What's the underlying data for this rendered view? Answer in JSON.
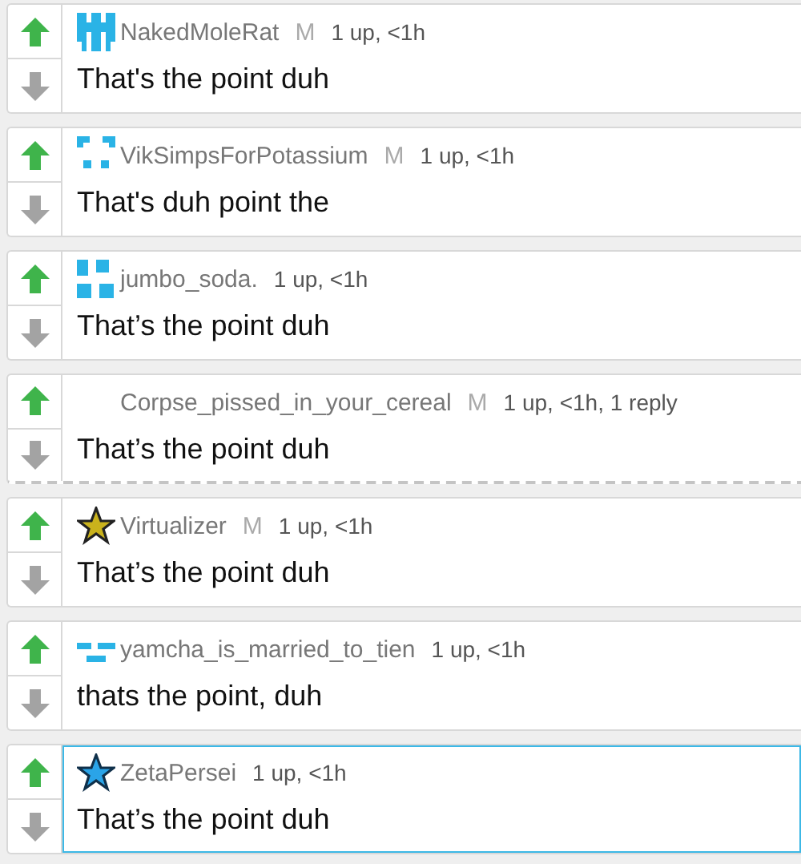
{
  "comments": [
    {
      "avatar": {
        "kind": "invader"
      },
      "username": "NakedMoleRat",
      "mod_badge": "M",
      "meta": "1 up, <1h",
      "text": "That's the point duh",
      "upvoted": true,
      "has_reply": false,
      "selected": false
    },
    {
      "avatar": {
        "kind": "corners"
      },
      "username": "VikSimpsForPotassium",
      "mod_badge": "M",
      "meta": "1 up, <1h",
      "text": "That's duh point the",
      "upvoted": true,
      "has_reply": false,
      "selected": false
    },
    {
      "avatar": {
        "kind": "squares"
      },
      "username": "jumbo_soda.",
      "meta": "1 up, <1h",
      "text": "That’s the point duh",
      "upvoted": true,
      "has_reply": false,
      "selected": false
    },
    {
      "username": "Corpse_pissed_in_your_cereal",
      "mod_badge": "M",
      "meta": "1 up, <1h, 1 reply",
      "text": "That’s the point duh",
      "upvoted": true,
      "has_reply": true,
      "selected": false
    },
    {
      "avatar": {
        "kind": "goldstar"
      },
      "username": "Virtualizer",
      "mod_badge": "M",
      "meta": "1 up, <1h",
      "text": "That’s the point duh",
      "upvoted": true,
      "has_reply": false,
      "selected": false
    },
    {
      "avatar": {
        "kind": "dashes"
      },
      "username": "yamcha_is_married_to_tien",
      "meta": "1 up, <1h",
      "text": "thats the point, duh",
      "upvoted": true,
      "has_reply": false,
      "selected": false
    },
    {
      "avatar": {
        "kind": "bluestar"
      },
      "username": "ZetaPersei",
      "meta": "1 up, <1h",
      "text": "That’s the point duh",
      "upvoted": true,
      "has_reply": false,
      "selected": true
    }
  ]
}
